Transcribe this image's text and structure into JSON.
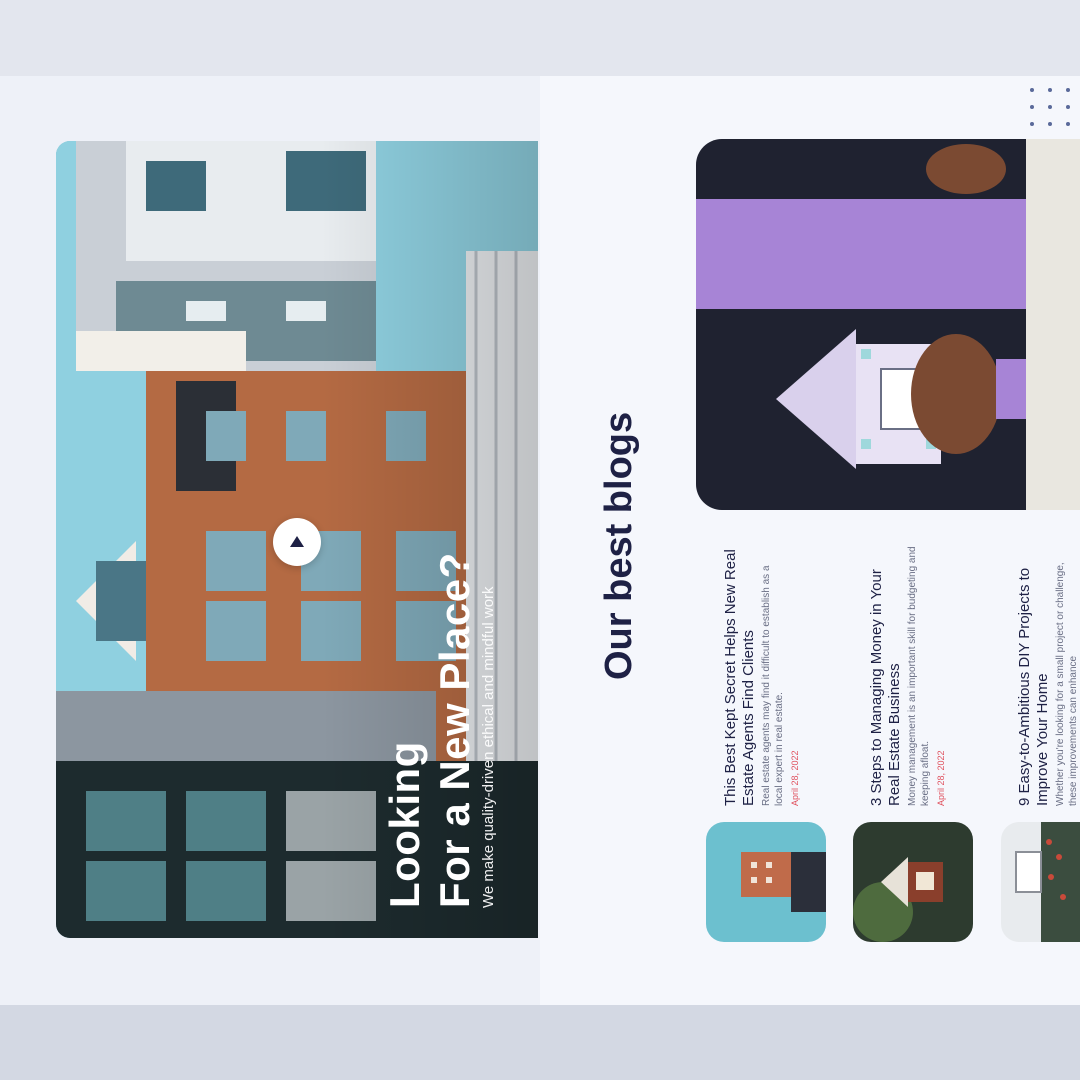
{
  "hero": {
    "title_line1": "Looking",
    "title_line2": "For a New Place?",
    "subtitle": "We make quality-driven ethical and mindful work"
  },
  "blog_section": {
    "title": "Our best blogs"
  },
  "posts": [
    {
      "title": "This Best Kept Secret Helps New Real Estate Agents Find Clients",
      "excerpt": "Real estate agents may find it difficult to establish as a local expert in real estate.",
      "date": "April 28, 2022"
    },
    {
      "title": "3 Steps to Managing Money in Your Real Estate Business",
      "excerpt": "Money management is an important skill for budgeting and keeping afloat.",
      "date": "April 28, 2022"
    },
    {
      "title": "9 Easy-to-Ambitious DIY Projects to Improve Your Home",
      "excerpt": "Whether you're looking for a small project or challenge, these improvements can enhance",
      "date": ""
    }
  ],
  "colors": {
    "title_navy": "#1e2145",
    "date_red": "#e0525f",
    "panel_bg": "#eef1f8"
  },
  "icons": {
    "play": "play-icon",
    "dots": "dots-grid-icon"
  }
}
